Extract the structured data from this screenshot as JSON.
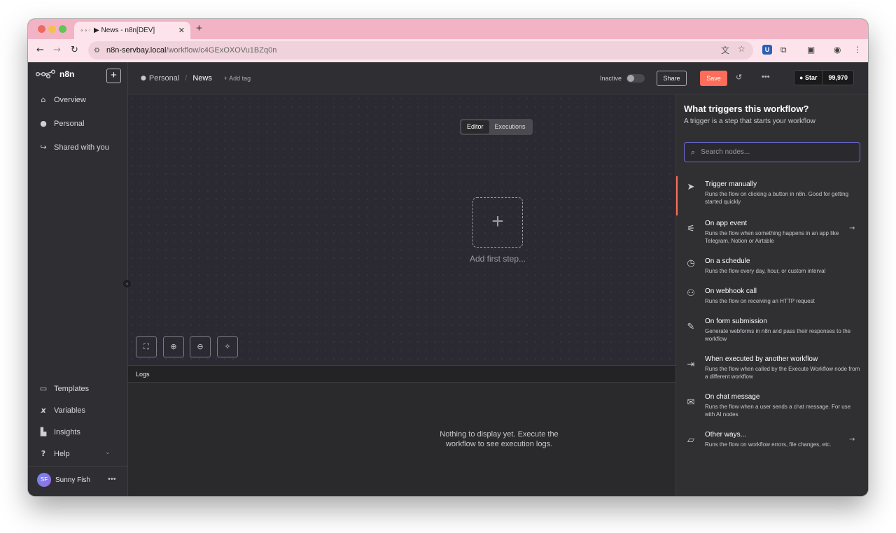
{
  "browser": {
    "tab_title": "News - n8n[DEV]",
    "tab_favicon": "▶",
    "url_host": "n8n-servbay.local",
    "url_path": "/workflow/c4GExOXOVu1BZq0n"
  },
  "sidebar": {
    "brand": "n8n",
    "items": [
      {
        "label": "Overview",
        "icon": "home-icon"
      },
      {
        "label": "Personal",
        "icon": "user-icon"
      },
      {
        "label": "Shared with you",
        "icon": "share-icon"
      }
    ],
    "bottom_items": [
      {
        "label": "Templates",
        "icon": "box-icon"
      },
      {
        "label": "Variables",
        "icon": "variable-icon"
      },
      {
        "label": "Insights",
        "icon": "chart-icon"
      },
      {
        "label": "Help",
        "icon": "question-icon"
      }
    ],
    "user": {
      "initials": "SF",
      "name": "Sunny Fish"
    }
  },
  "header": {
    "project": "Personal",
    "workflow_name": "News",
    "add_tag": "+ Add tag",
    "status_label": "Inactive",
    "share_label": "Share",
    "save_label": "Save",
    "github_star_label": "Star",
    "github_star_count": "99,970"
  },
  "canvas": {
    "tabs": [
      "Editor",
      "Executions"
    ],
    "active_tab": "Editor",
    "add_first_step_label": "Add first step..."
  },
  "logs": {
    "title": "Logs",
    "empty_message": "Nothing to display yet. Execute the workflow to see execution logs."
  },
  "trigger_panel": {
    "title": "What triggers this workflow?",
    "subtitle": "A trigger is a step that starts your workflow",
    "search_placeholder": "Search nodes...",
    "triggers": [
      {
        "name": "Trigger manually",
        "description": "Runs the flow on clicking a button in n8n. Good for getting started quickly",
        "icon": "cursor-icon",
        "has_arrow": false
      },
      {
        "name": "On app event",
        "description": "Runs the flow when something happens in an app like Telegram, Notion or Airtable",
        "icon": "satellite-icon",
        "has_arrow": true
      },
      {
        "name": "On a schedule",
        "description": "Runs the flow every day, hour, or custom interval",
        "icon": "clock-icon",
        "has_arrow": false
      },
      {
        "name": "On webhook call",
        "description": "Runs the flow on receiving an HTTP request",
        "icon": "webhook-icon",
        "has_arrow": false
      },
      {
        "name": "On form submission",
        "description": "Generate webforms in n8n and pass their responses to the workflow",
        "icon": "form-icon",
        "has_arrow": false
      },
      {
        "name": "When executed by another workflow",
        "description": "Runs the flow when called by the Execute Workflow node from a different workflow",
        "icon": "sign-in-icon",
        "has_arrow": false
      },
      {
        "name": "On chat message",
        "description": "Runs the flow when a user sends a chat message. For use with AI nodes",
        "icon": "comments-icon",
        "has_arrow": false
      },
      {
        "name": "Other ways...",
        "description": "Runs the flow on workflow errors, file changes, etc.",
        "icon": "folder-open-icon",
        "has_arrow": true
      }
    ]
  },
  "colors": {
    "accent": "#ff6d5a",
    "search_focus": "#6b6bd8",
    "tab_strip": "#f2b4c5"
  }
}
